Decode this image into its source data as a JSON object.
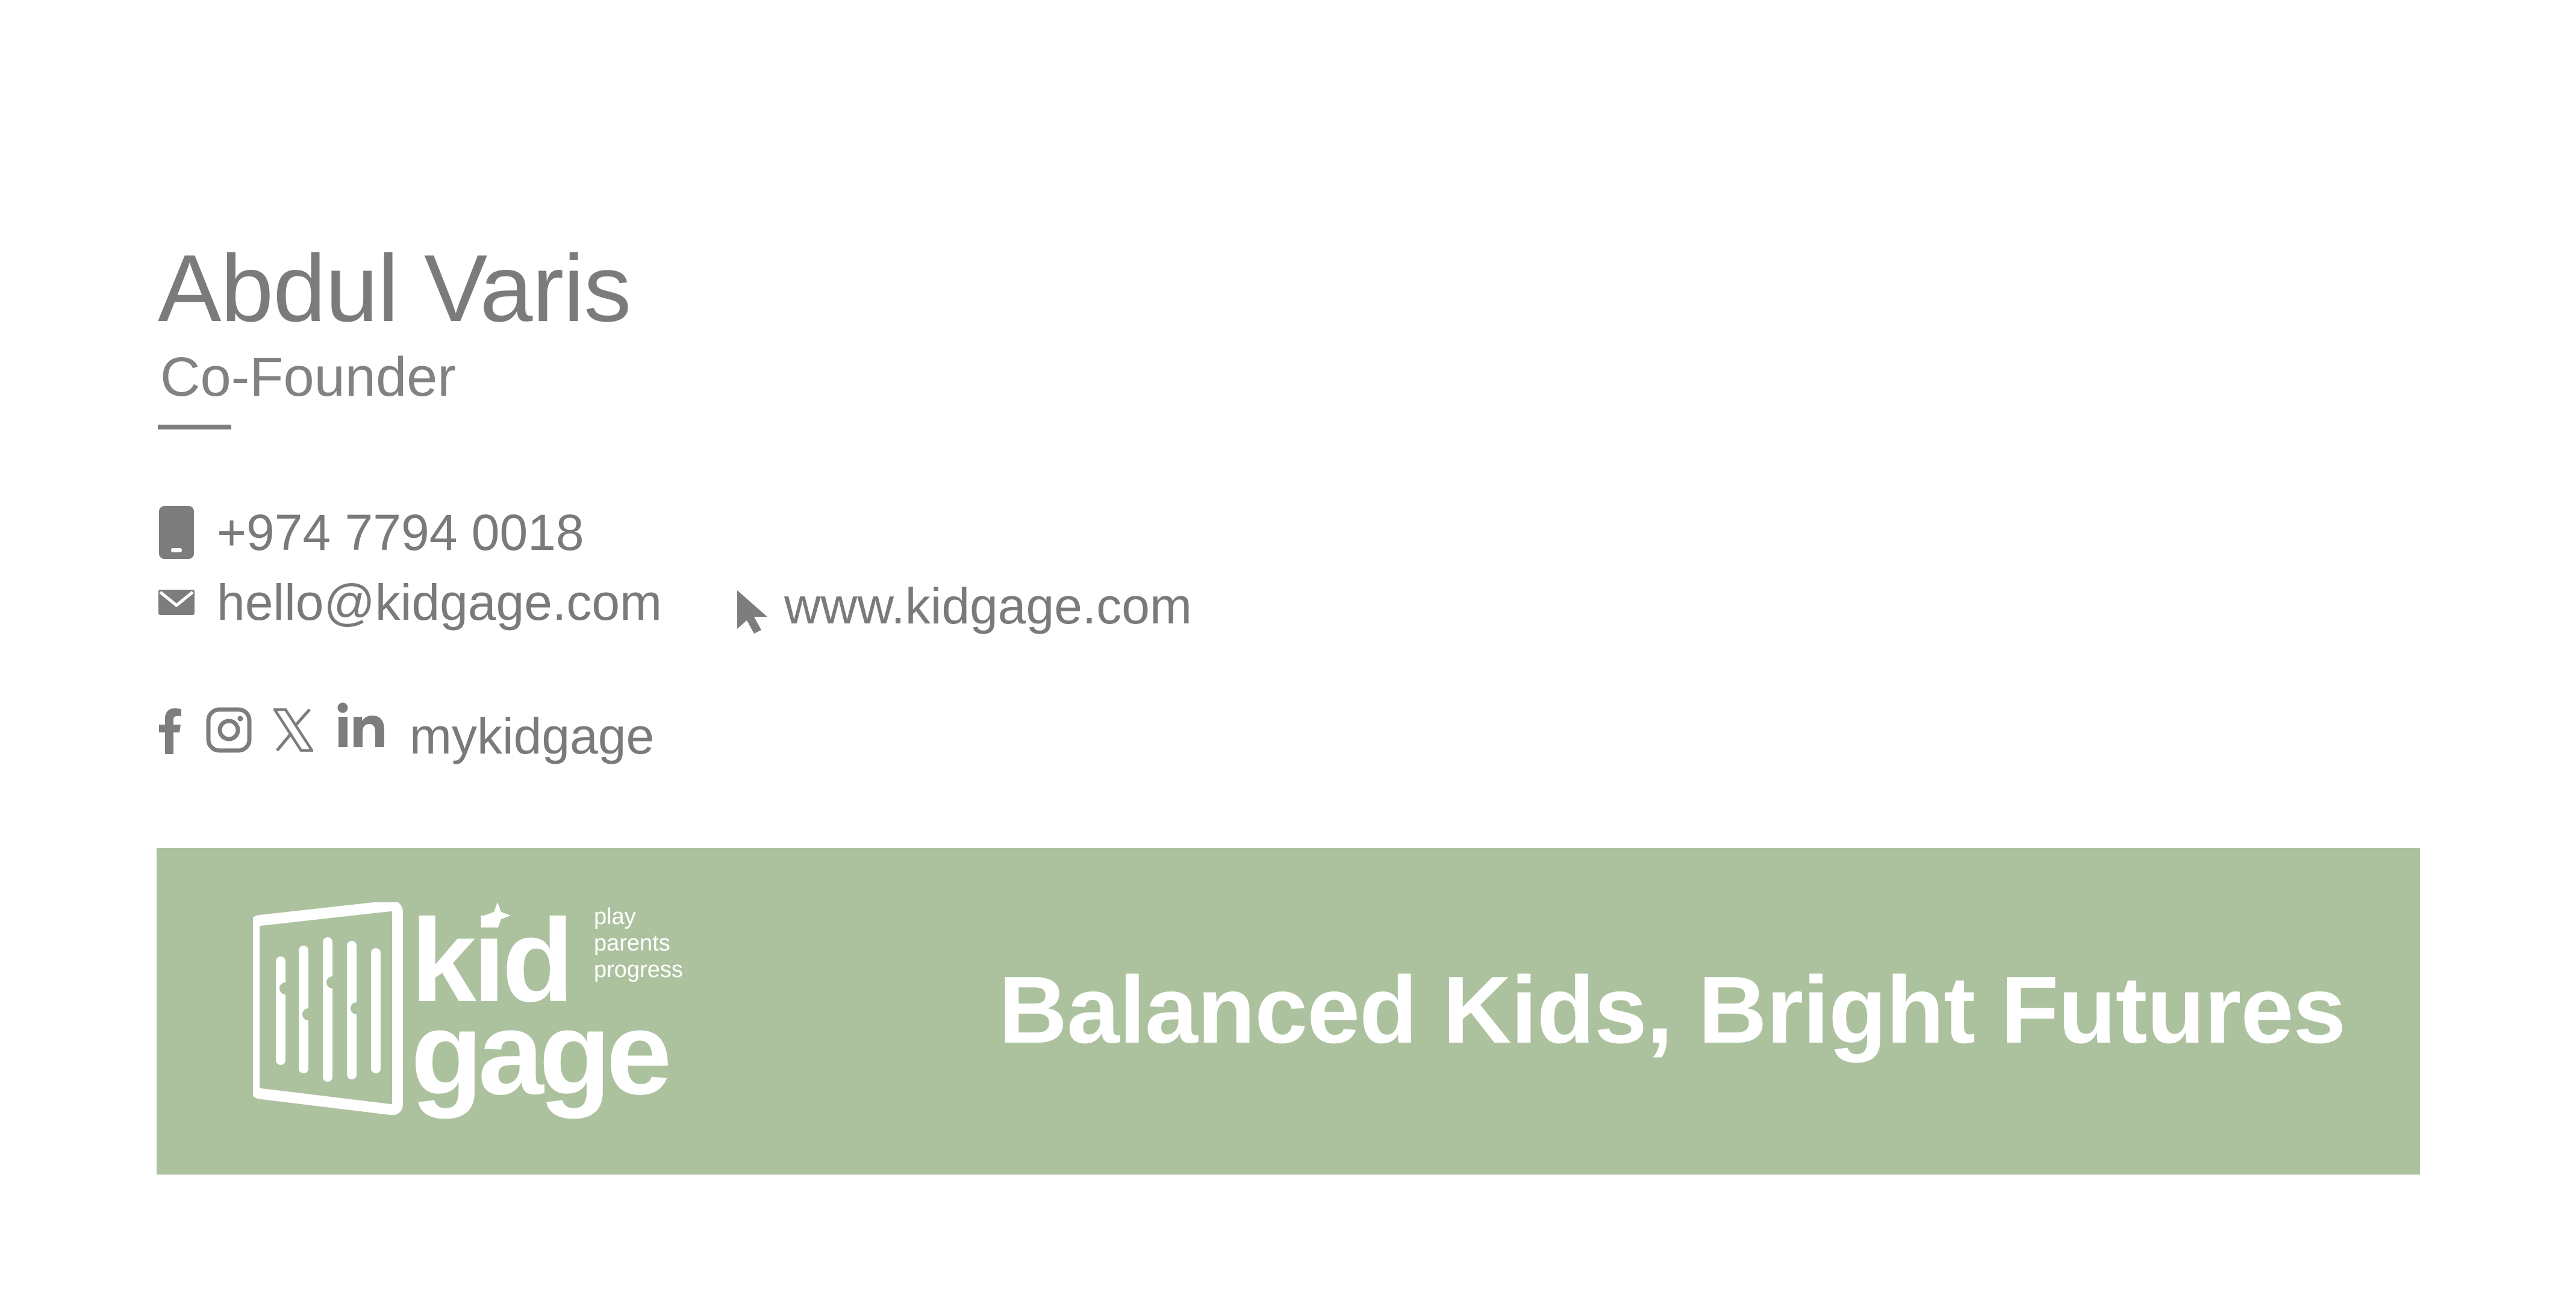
{
  "person": {
    "name": "Abdul Varis",
    "title": "Co-Founder"
  },
  "contact": {
    "phone": "+974 7794 0018",
    "email": "hello@kidgage.com",
    "website": "www.kidgage.com",
    "social_handle": "mykidgage",
    "icons": {
      "phone": "mobile-phone-icon",
      "email": "envelope-icon",
      "website": "cursor-pointer-icon",
      "social": [
        "facebook-icon",
        "instagram-icon",
        "x-icon",
        "linkedin-icon"
      ]
    }
  },
  "banner": {
    "logo": {
      "word_top": "kid",
      "word_bottom": "gage",
      "tagline_lines": [
        "play",
        "parents",
        "progress"
      ]
    },
    "tagline": "Balanced Kids, Bright Futures",
    "background_color": "#acc29f",
    "text_color": "#ffffff"
  },
  "colors": {
    "text_gray": "#7d7d7d"
  }
}
